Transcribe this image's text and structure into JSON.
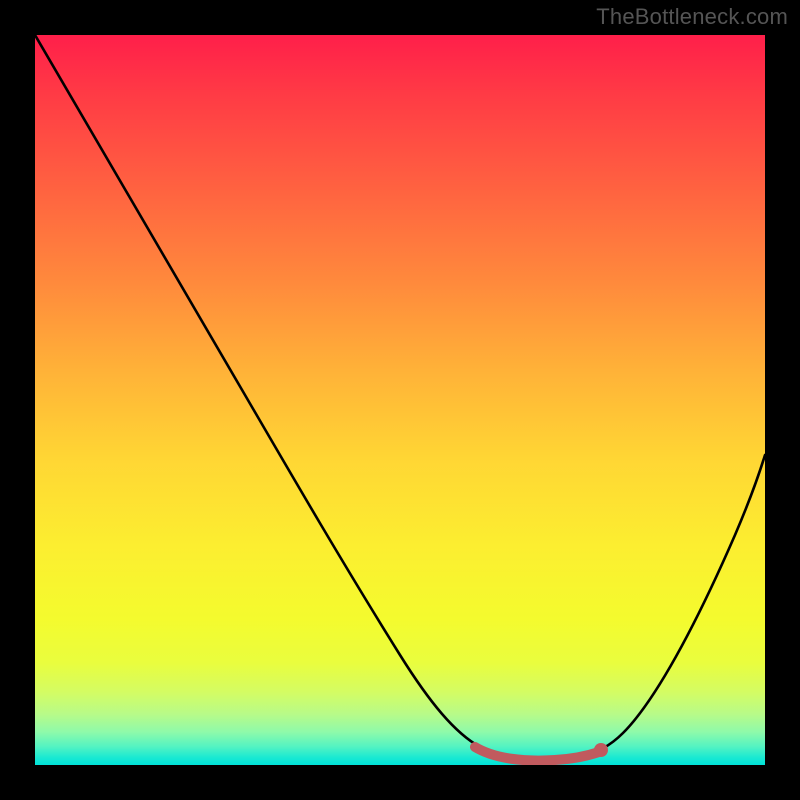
{
  "watermark": "TheBottleneck.com",
  "chart_data": {
    "type": "line",
    "title": "",
    "xlabel": "",
    "ylabel": "",
    "xlim": [
      0,
      100
    ],
    "ylim": [
      0,
      100
    ],
    "series": [
      {
        "name": "bottleneck-curve",
        "x": [
          0,
          5,
          10,
          15,
          20,
          25,
          30,
          35,
          40,
          45,
          50,
          55,
          58,
          60,
          62,
          64,
          66,
          68,
          70,
          72,
          74,
          76,
          78,
          80,
          85,
          90,
          95,
          100
        ],
        "y": [
          100,
          93,
          86,
          79,
          72,
          65,
          58,
          51,
          44,
          37,
          30,
          22,
          17,
          13,
          10,
          7,
          4.5,
          2.5,
          1,
          0.4,
          0.5,
          1.2,
          2.8,
          5,
          12,
          22,
          33,
          45
        ]
      }
    ],
    "flat_segment": {
      "x_start": 60,
      "x_end": 77,
      "color": "#c15a5e"
    },
    "marker": {
      "x": 77,
      "y": 2.2,
      "color": "#c15a5e"
    },
    "gradient_stops": [
      {
        "pos": 0.0,
        "color": "#ff1f4a"
      },
      {
        "pos": 0.5,
        "color": "#ffd634"
      },
      {
        "pos": 0.85,
        "color": "#f4fb2e"
      },
      {
        "pos": 1.0,
        "color": "#00e2d8"
      }
    ]
  }
}
